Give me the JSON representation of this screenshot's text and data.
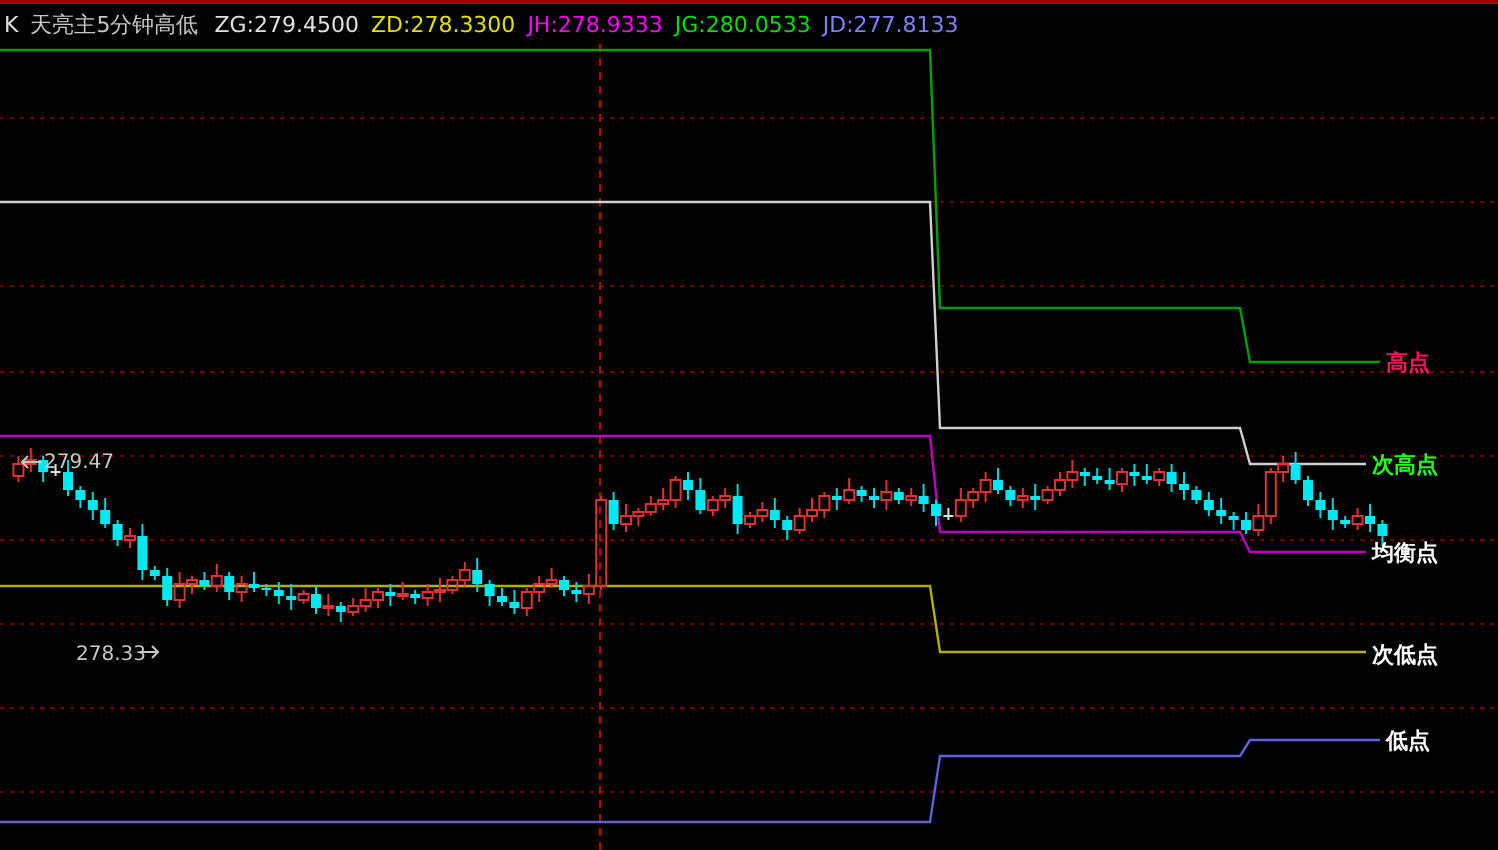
{
  "header": {
    "period": "K",
    "title": "天亮主5分钟高低",
    "indicators": [
      {
        "label": "ZG:279.4500",
        "color": "#e0e0e0"
      },
      {
        "label": "ZD:278.3300",
        "color": "#e0e000"
      },
      {
        "label": "JH:278.9333",
        "color": "#ff00ff"
      },
      {
        "label": "JG:280.0533",
        "color": "#00e000"
      },
      {
        "label": "JD:277.8133",
        "color": "#8080ff"
      }
    ]
  },
  "chart": {
    "max_label": "279.47",
    "min_label": "278.33",
    "lines": [
      {
        "color": "#00a000"
      },
      {
        "color": "#d0d0d0"
      },
      {
        "color": "#c000c0"
      },
      {
        "color": "#b0b000"
      },
      {
        "color": "#6060e0"
      }
    ],
    "labels": [
      {
        "text": "高点",
        "color": "#ff1060"
      },
      {
        "text": "次高点",
        "color": "#20ff20"
      },
      {
        "text": "均衡点",
        "color": "#ffffff"
      },
      {
        "text": "次低点",
        "color": "#ffffff"
      },
      {
        "text": "低点",
        "color": "#ffffff"
      }
    ]
  }
}
